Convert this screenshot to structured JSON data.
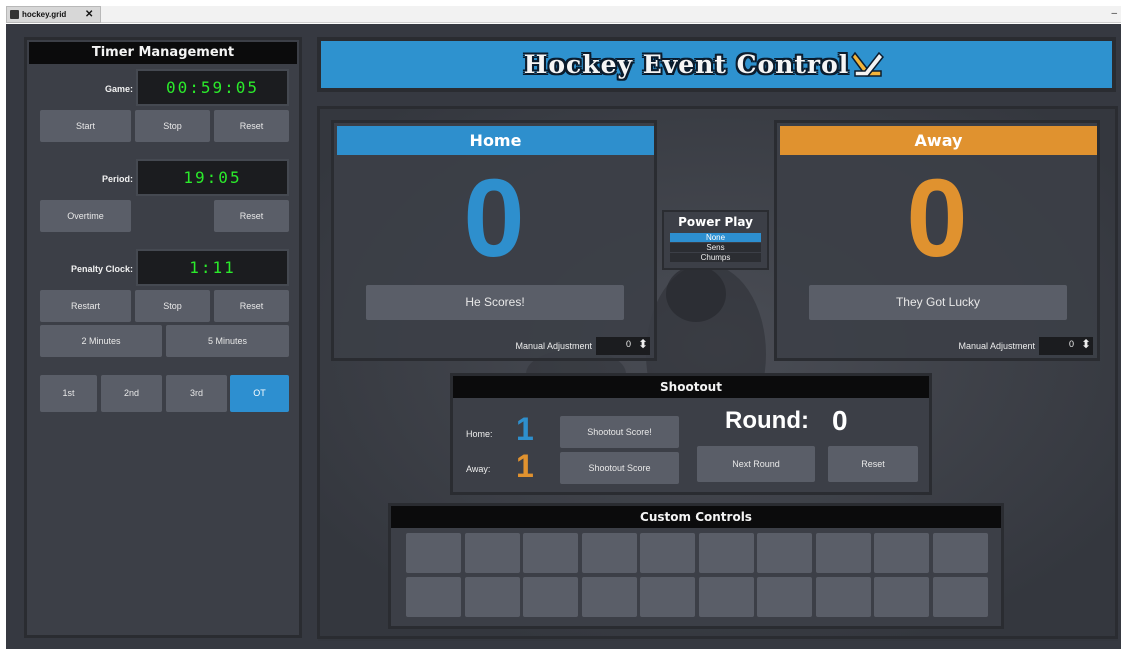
{
  "tab": {
    "title": "hockey.grid",
    "close": "✕"
  },
  "window": {
    "minimize": "–"
  },
  "timer": {
    "title": "Timer Management",
    "game": {
      "label": "Game:",
      "value": "00:59:05",
      "buttons": [
        "Start",
        "Stop",
        "Reset"
      ]
    },
    "period": {
      "label": "Period:",
      "value": "19:05",
      "buttons": [
        "Overtime",
        "Reset"
      ]
    },
    "penalty": {
      "label": "Penalty Clock:",
      "value": "1:11",
      "buttons": [
        "Restart",
        "Stop",
        "Reset"
      ],
      "minutes": [
        "2 Minutes",
        "5 Minutes"
      ]
    },
    "periods": [
      "1st",
      "2nd",
      "3rd",
      "OT"
    ],
    "active_period": "OT"
  },
  "banner": {
    "title": "Hockey Event Control"
  },
  "home": {
    "name": "Home",
    "score": "0",
    "button": "He Scores!",
    "adj_label": "Manual Adjustment",
    "adj_value": "0",
    "color": "#2e8fcd"
  },
  "away": {
    "name": "Away",
    "score": "0",
    "button": "They Got Lucky",
    "adj_label": "Manual Adjustment",
    "adj_value": "0",
    "color": "#e0922f"
  },
  "powerplay": {
    "title": "Power Play",
    "options": [
      "None",
      "Sens",
      "Chumps"
    ],
    "selected": "None"
  },
  "shootout": {
    "title": "Shootout",
    "home_label": "Home:",
    "home_score": "1",
    "home_button": "Shootout Score!",
    "away_label": "Away:",
    "away_score": "1",
    "away_button": "Shootout Score",
    "round_label": "Round:",
    "round_value": "0",
    "next_button": "Next Round",
    "reset_button": "Reset"
  },
  "custom": {
    "title": "Custom Controls",
    "rows": 2,
    "cols": 10
  }
}
